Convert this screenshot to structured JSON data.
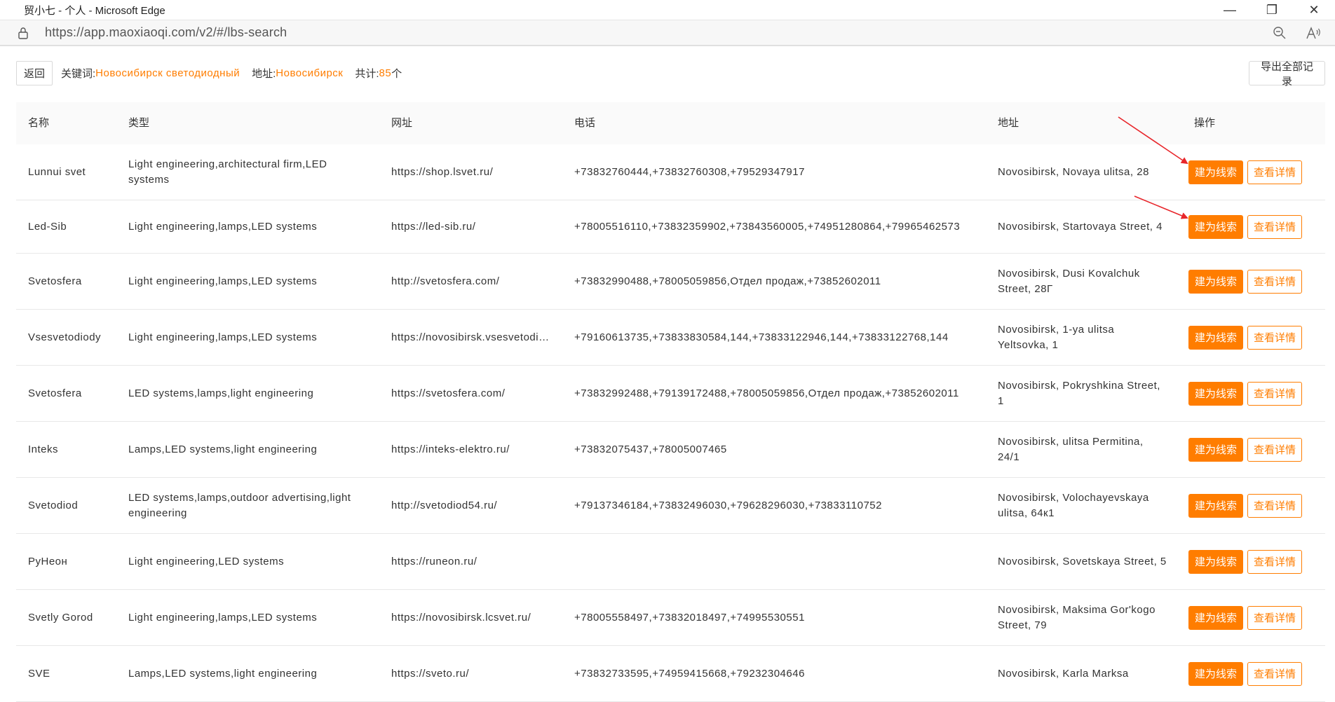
{
  "window": {
    "title": "贸小七 - 个人 - Microsoft Edge",
    "controls": [
      "—",
      "❐",
      "✕"
    ]
  },
  "address": {
    "url": "https://app.maoxiaoqi.com/v2/#/lbs-search"
  },
  "toolbar": {
    "back_label": "返回",
    "keyword_label": "关键词:",
    "keyword_value": "Новосибирск светодиодный",
    "address_label": "地址:",
    "address_value": "Новосибирск",
    "total_label": "共计:",
    "total_value": "85",
    "total_unit": "个",
    "export_label": "导出全部记录"
  },
  "table": {
    "headers": [
      "名称",
      "类型",
      "网址",
      "电话",
      "地址",
      "操作"
    ],
    "lead_label": "建为线索",
    "detail_label": "查看详情",
    "rows": [
      {
        "name": "Lunnui svet",
        "type": "Light engineering,architectural firm,LED systems",
        "url": "https://shop.lsvet.ru/",
        "phone": "+73832760444,+73832760308,+79529347917",
        "address": "Novosibirsk, Novaya ulitsa, 28"
      },
      {
        "name": "Led-Sib",
        "type": "Light engineering,lamps,LED systems",
        "url": "https://led-sib.ru/",
        "phone": "+78005516110,+73832359902,+73843560005,+74951280864,+79965462573",
        "address": "Novosibirsk, Startovaya Street, 4"
      },
      {
        "name": "Svetosfera",
        "type": "Light engineering,lamps,LED systems",
        "url": "http://svetosfera.com/",
        "phone": "+73832990488,+78005059856,Отдел продаж,+73852602011",
        "address": "Novosibirsk, Dusi Kovalchuk Street, 28Г"
      },
      {
        "name": "Vsesvetodiody",
        "type": "Light engineering,lamps,LED systems",
        "url": "https://novosibirsk.vsesvetodiody.ru/",
        "phone": "+79160613735,+73833830584,144,+73833122946,144,+73833122768,144",
        "address": "Novosibirsk, 1-ya ulitsa Yeltsovka, 1"
      },
      {
        "name": "Svetosfera",
        "type": "LED systems,lamps,light engineering",
        "url": "https://svetosfera.com/",
        "phone": "+73832992488,+79139172488,+78005059856,Отдел продаж,+73852602011",
        "address": "Novosibirsk, Pokryshkina Street, 1"
      },
      {
        "name": "Inteks",
        "type": "Lamps,LED systems,light engineering",
        "url": "https://inteks-elektro.ru/",
        "phone": "+73832075437,+78005007465",
        "address": "Novosibirsk, ulitsa Permitina, 24/1"
      },
      {
        "name": "Svetodiod",
        "type": "LED systems,lamps,outdoor advertising,light engineering",
        "url": "http://svetodiod54.ru/",
        "phone": "+79137346184,+73832496030,+79628296030,+73833110752",
        "address": "Novosibirsk, Volochayevskaya ulitsa, 64к1"
      },
      {
        "name": "РуНеон",
        "type": "Light engineering,LED systems",
        "url": "https://runeon.ru/",
        "phone": "",
        "address": "Novosibirsk, Sovetskaya Street, 5"
      },
      {
        "name": "Svetly Gorod",
        "type": "Light engineering,lamps,LED systems",
        "url": "https://novosibirsk.lcsvet.ru/",
        "phone": "+78005558497,+73832018497,+74995530551",
        "address": "Novosibirsk, Maksima Gor'kogo Street, 79"
      },
      {
        "name": "SVE",
        "type": "Lamps,LED systems,light engineering",
        "url": "https://sveto.ru/",
        "phone": "+73832733595,+74959415668,+79232304646",
        "address": "Novosibirsk, Karla Marksa"
      }
    ]
  },
  "colors": {
    "accent": "#ff7d00",
    "annotation_arrow": "#e8262b"
  }
}
